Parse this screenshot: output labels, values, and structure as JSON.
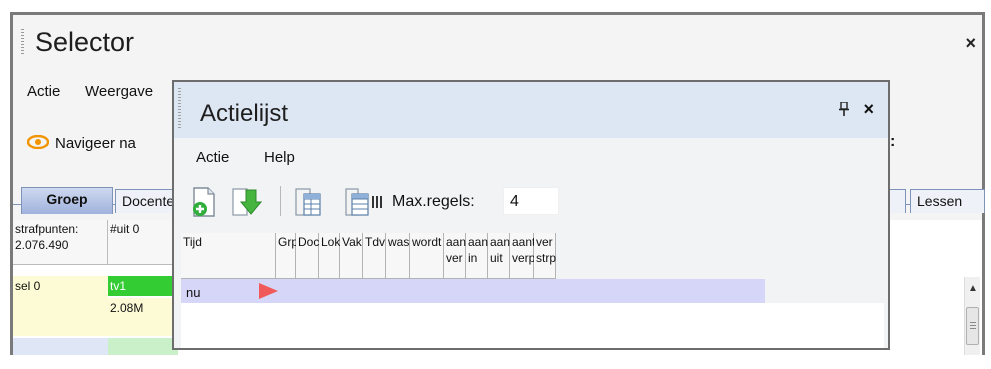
{
  "selector": {
    "title": "Selector",
    "close_glyph": "×",
    "menu": [
      "Actie",
      "Weergave"
    ],
    "nav_label": "Navigeer na",
    "colon": ":",
    "tabs": [
      "Groep",
      "Docenten",
      "",
      "Lessen"
    ],
    "header_cells": [
      "strafpunten: 2.076.490",
      "#uit 0"
    ],
    "row_cells": [
      "sel 0",
      "tv1",
      "2.08M"
    ],
    "icons": [
      "eye-icon",
      "scroll-up-icon"
    ],
    "colors": {
      "accent_tab": "#9fb2dd",
      "row_highlight": "#fdfbd6",
      "green_cell": "#33cc33"
    }
  },
  "actielijst": {
    "title": "Actielijst",
    "close_glyph": "×",
    "pin_glyph": "pin-icon",
    "menu": [
      "Actie",
      "Help"
    ],
    "max_label": "Max.regels:",
    "max_value": "4",
    "icons": [
      "new-document-icon",
      "download-arrow-icon",
      "table-icon",
      "columns-settings-icon",
      "play-triangle-icon"
    ],
    "columns": [
      "Tijd",
      "Grp",
      "Doc",
      "Lok",
      "Vak",
      "Tdv",
      "was",
      "wordt",
      "aant ver",
      "aant in",
      "aant uit",
      "aant verp",
      "ver strp"
    ],
    "rows": [
      {
        "tijd": "nu"
      }
    ],
    "colors": {
      "titlebar": "#dde7f3",
      "row_bg": "#d6d6f8",
      "play": "#f05a5a"
    }
  }
}
